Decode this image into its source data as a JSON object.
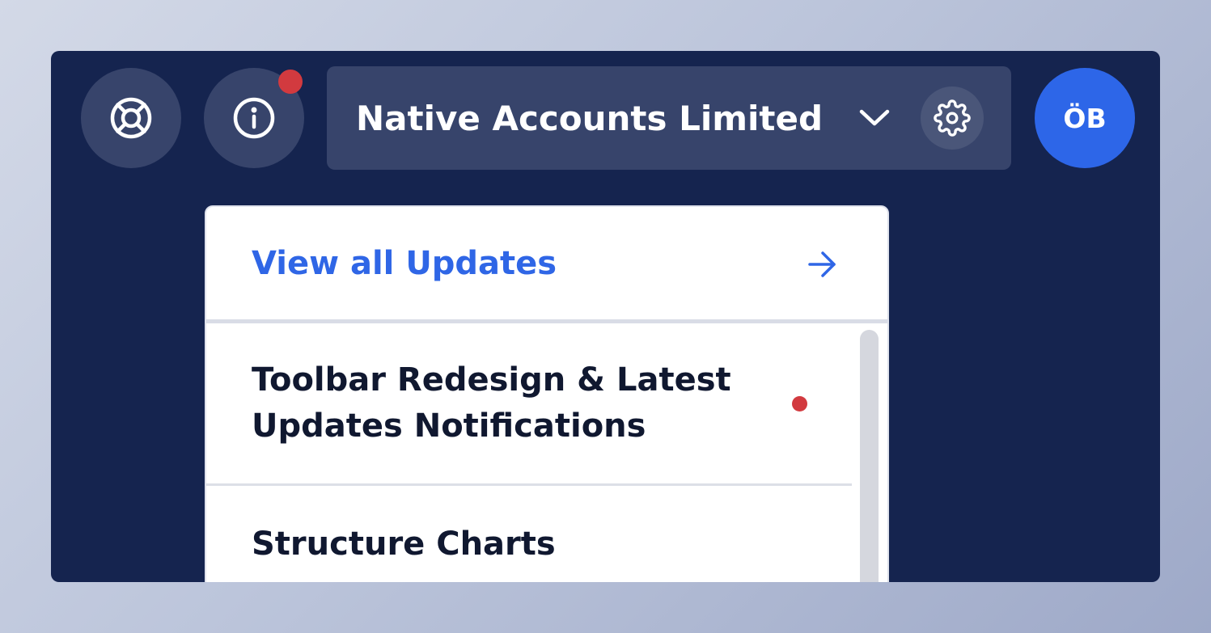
{
  "toolbar": {
    "help_icon": "lifebuoy-icon",
    "info_icon": "info-icon",
    "has_unread_updates": true,
    "account": {
      "name": "Native Accounts Limited",
      "dropdown_icon": "chevron-down-icon",
      "settings_icon": "gear-icon"
    },
    "avatar": {
      "initials": "ÖB"
    }
  },
  "updates_dropdown": {
    "header_label": "View all Updates",
    "header_icon": "arrow-right-icon",
    "items": [
      {
        "title": "Toolbar Redesign & Latest Updates Notifications",
        "unread": true
      },
      {
        "title": "Structure Charts",
        "unread": false
      }
    ]
  },
  "colors": {
    "window_background": "#15244f",
    "button_background": "#37446b",
    "accent_blue": "#2f66e6",
    "avatar_blue": "#2d66e8",
    "notification_red": "#d23a3f"
  }
}
